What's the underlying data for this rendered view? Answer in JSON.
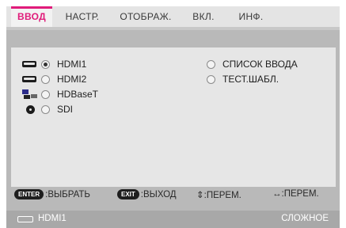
{
  "tabs": [
    {
      "label": "ВВОД",
      "active": true
    },
    {
      "label": "НАСТР."
    },
    {
      "label": "ОТОБРАЖ."
    },
    {
      "label": "ВКЛ."
    },
    {
      "label": "ИНФ."
    }
  ],
  "inputs": [
    {
      "label": "HDMI1",
      "icon": "hdmi-icon",
      "selected": true
    },
    {
      "label": "HDMI2",
      "icon": "hdmi-icon",
      "selected": false
    },
    {
      "label": "HDBaseT",
      "icon": "hdbaset-icon",
      "selected": false
    },
    {
      "label": "SDI",
      "icon": "sdi-icon",
      "selected": false
    }
  ],
  "options": [
    {
      "label": "СПИСОК ВВОДА"
    },
    {
      "label": "ТЕСТ.ШАБЛ."
    }
  ],
  "hints": {
    "enter_key": "ENTER",
    "enter_label": ":ВЫБРАТЬ",
    "exit_key": "EXIT",
    "exit_label": ":ВЫХОД",
    "updown_label": "⇕:ПЕРЕМ.",
    "leftright_label": "↔:ПЕРЕМ."
  },
  "status": {
    "source": "HDMI1",
    "mode": "СЛОЖНОЕ"
  },
  "colors": {
    "accent": "#e01b7a",
    "frame": "#b9b9b9",
    "panel": "#e6e6e6",
    "status_bar": "#a8a8a8"
  }
}
